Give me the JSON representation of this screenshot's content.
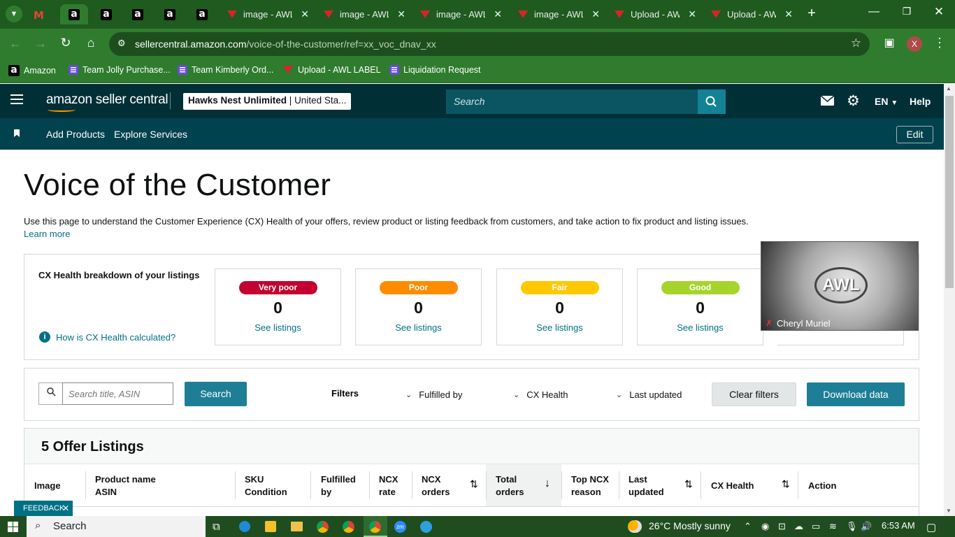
{
  "browser": {
    "tabs": [
      {
        "title": "",
        "icon": "gmail-icon"
      },
      {
        "title": "",
        "icon": "amazon-icon"
      },
      {
        "title": "",
        "icon": "amazon-icon"
      },
      {
        "title": "",
        "icon": "amazon-icon"
      },
      {
        "title": "",
        "icon": "amazon-icon"
      },
      {
        "title": "",
        "icon": "amazon-icon"
      },
      {
        "title": "image - AWL",
        "icon": "awl-icon"
      },
      {
        "title": "image - AWL",
        "icon": "awl-icon"
      },
      {
        "title": "image - AWL",
        "icon": "awl-icon"
      },
      {
        "title": "image - AWL",
        "icon": "awl-icon"
      },
      {
        "title": "Upload - AW",
        "icon": "awl-icon"
      },
      {
        "title": "Upload - AW",
        "icon": "awl-icon"
      }
    ],
    "url_host": "sellercentral.amazon.com",
    "url_path": "/voice-of-the-customer/ref=xx_voc_dnav_xx",
    "profile_initial": "X",
    "bookmarks": [
      {
        "label": "Amazon",
        "icon": "amazon-icon"
      },
      {
        "label": "Team Jolly Purchase...",
        "icon": "list-icon"
      },
      {
        "label": "Team Kimberly Ord...",
        "icon": "list-icon"
      },
      {
        "label": "Upload - AWL LABEL",
        "icon": "awl-icon"
      },
      {
        "label": "Liquidation Request",
        "icon": "list-icon"
      }
    ]
  },
  "header": {
    "logo": "amazon seller central",
    "store_name": "Hawks Nest Unlimited",
    "store_region": "United Sta...",
    "search_placeholder": "Search",
    "lang": "EN",
    "help": "Help"
  },
  "nav": {
    "items": [
      "Add Products",
      "Explore Services"
    ],
    "edit": "Edit"
  },
  "page": {
    "title": "Voice of the Customer",
    "intro": "Use this page to understand the Customer Experience (CX) Health of your offers, review product or listing feedback from customers, and take action to fix product and listing issues.",
    "learn_more": "Learn more",
    "cx_heading": "CX Health breakdown of your listings",
    "cx_help": "How is CX Health calculated?",
    "cards": [
      {
        "label": "Very poor",
        "count": "0",
        "link": "See listings",
        "color": "#c40030",
        "text": "#ffffff"
      },
      {
        "label": "Poor",
        "count": "0",
        "link": "See listings",
        "color": "#ff8c00",
        "text": "#ffffff"
      },
      {
        "label": "Fair",
        "count": "0",
        "link": "See listings",
        "color": "#ffc800",
        "text": "#ffffff"
      },
      {
        "label": "Good",
        "count": "0",
        "link": "See listings",
        "color": "#a6d42b",
        "text": "#ffffff"
      }
    ]
  },
  "filters": {
    "search_placeholder": "Search title, ASIN",
    "search_button": "Search",
    "label": "Filters",
    "options": [
      "Fulfilled by",
      "CX Health",
      "Last updated"
    ],
    "clear": "Clear filters",
    "download": "Download data"
  },
  "listings": {
    "title": "5 Offer Listings",
    "columns": [
      {
        "line1": "Image",
        "line2": ""
      },
      {
        "line1": "Product name",
        "line2": "ASIN"
      },
      {
        "line1": "SKU",
        "line2": "Condition"
      },
      {
        "line1": "Fulfilled",
        "line2": "by"
      },
      {
        "line1": "NCX",
        "line2": "rate"
      },
      {
        "line1": "NCX",
        "line2": "orders"
      },
      {
        "line1": "Total",
        "line2": "orders"
      },
      {
        "line1": "Top NCX",
        "line2": "reason"
      },
      {
        "line1": "Last",
        "line2": "updated"
      },
      {
        "line1": "CX Health",
        "line2": ""
      },
      {
        "line1": "Action",
        "line2": ""
      }
    ]
  },
  "video": {
    "name": "Cheryl Muriel",
    "logo": "AWL"
  },
  "feedback": "FEEDBACK",
  "taskbar": {
    "search": "Search",
    "weather": "26°C  Mostly sunny",
    "time": "6:53 AM"
  }
}
